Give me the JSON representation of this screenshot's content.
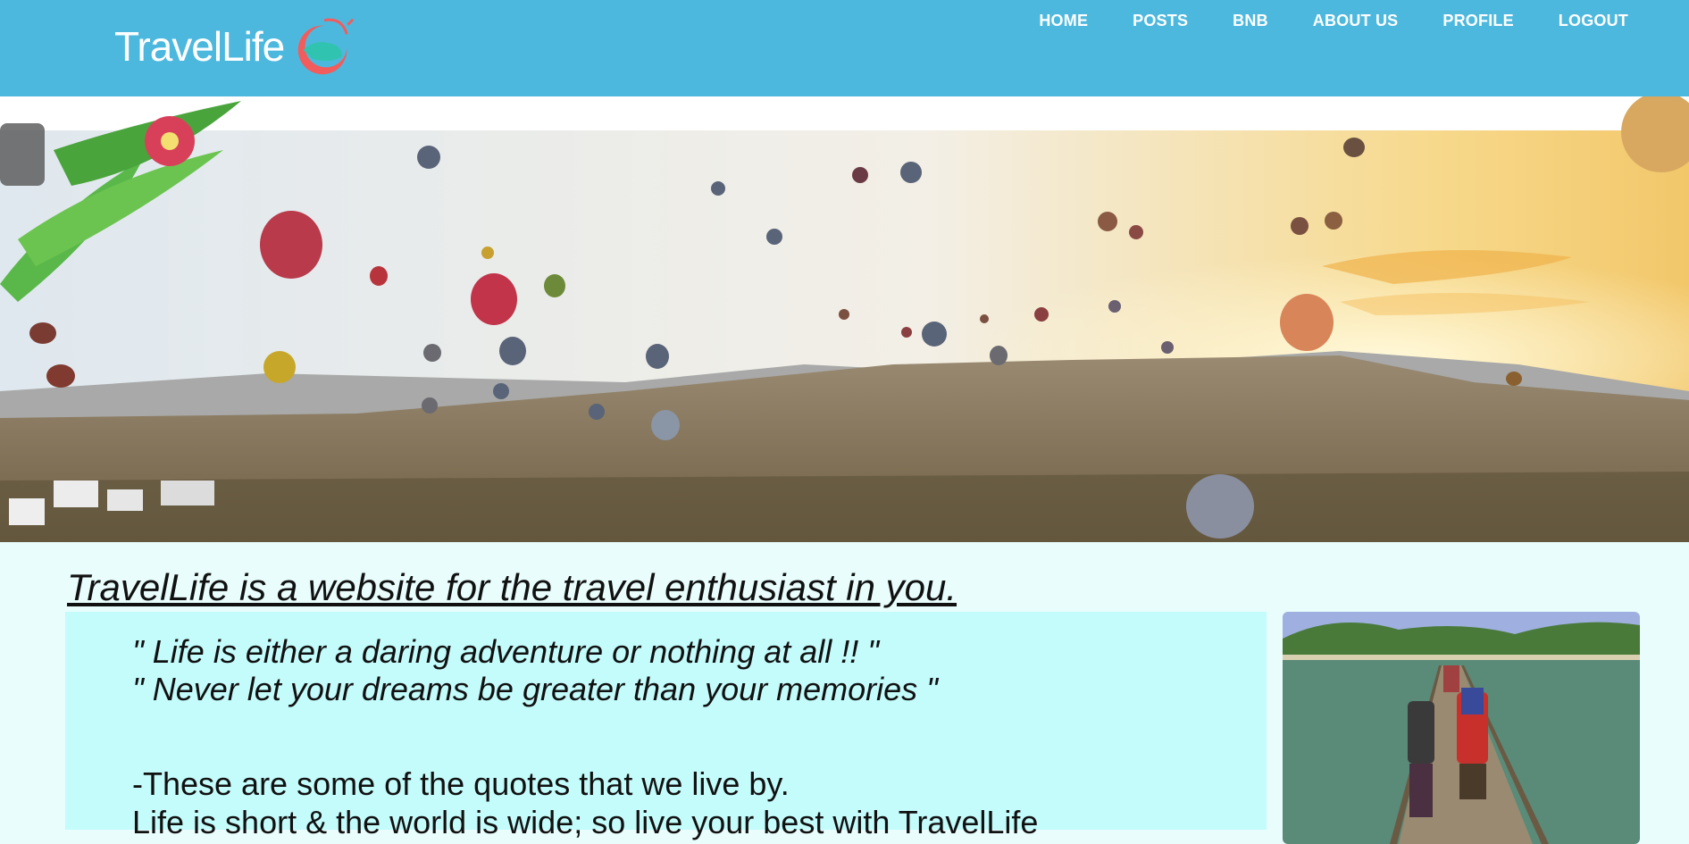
{
  "brand": {
    "name": "TravelLife",
    "colors": {
      "header": "#4db8dd",
      "logo_accent": "#f25c5c",
      "logo_teal": "#2fc3b0"
    }
  },
  "nav": {
    "items": [
      {
        "label": "HOME"
      },
      {
        "label": "POSTS"
      },
      {
        "label": "BNB"
      },
      {
        "label": "ABOUT US"
      },
      {
        "label": "PROFILE"
      },
      {
        "label": "LOGOUT"
      }
    ]
  },
  "content": {
    "tagline": "TravelLife is a website for the travel enthusiast in you.",
    "quotes": [
      "\" Life is either a daring adventure or nothing at all !! \"",
      "\" Never let your dreams be greater than your memories \""
    ],
    "body": [
      "-These are some of the quotes that we live by.",
      "  Life is short & the world is wide; so live your best with TravelLife"
    ]
  }
}
